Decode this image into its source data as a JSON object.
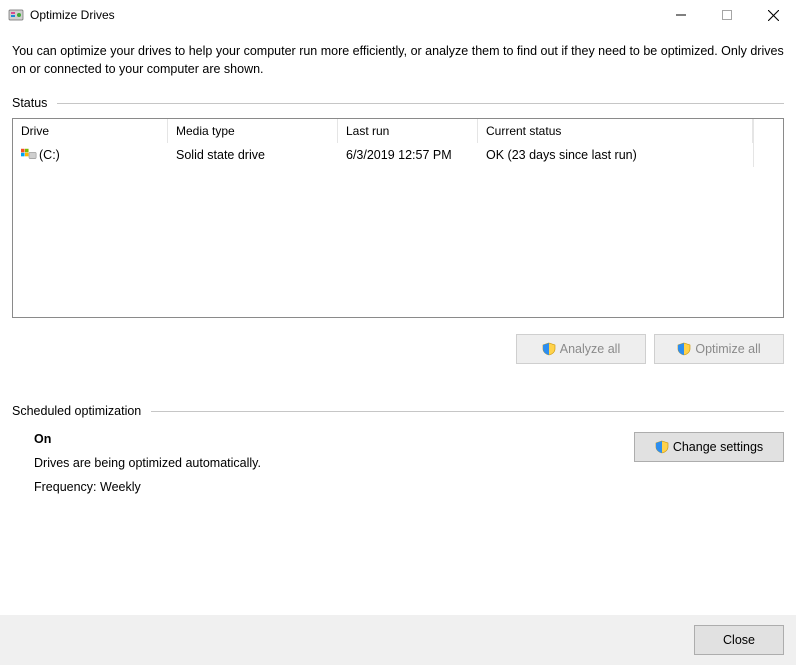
{
  "window": {
    "title": "Optimize Drives"
  },
  "intro": "You can optimize your drives to help your computer run more efficiently, or analyze them to find out if they need to be optimized. Only drives on or connected to your computer are shown.",
  "status_section": {
    "label": "Status",
    "columns": {
      "drive": "Drive",
      "media": "Media type",
      "last_run": "Last run",
      "current_status": "Current status"
    },
    "rows": [
      {
        "drive": "(C:)",
        "media": "Solid state drive",
        "last_run": "6/3/2019 12:57 PM",
        "current_status": "OK (23 days since last run)"
      }
    ]
  },
  "buttons": {
    "analyze_all": "Analyze all",
    "optimize_all": "Optimize all",
    "change_settings": "Change settings",
    "close": "Close"
  },
  "scheduled": {
    "label": "Scheduled optimization",
    "state": "On",
    "desc": "Drives are being optimized automatically.",
    "frequency": "Frequency: Weekly"
  }
}
